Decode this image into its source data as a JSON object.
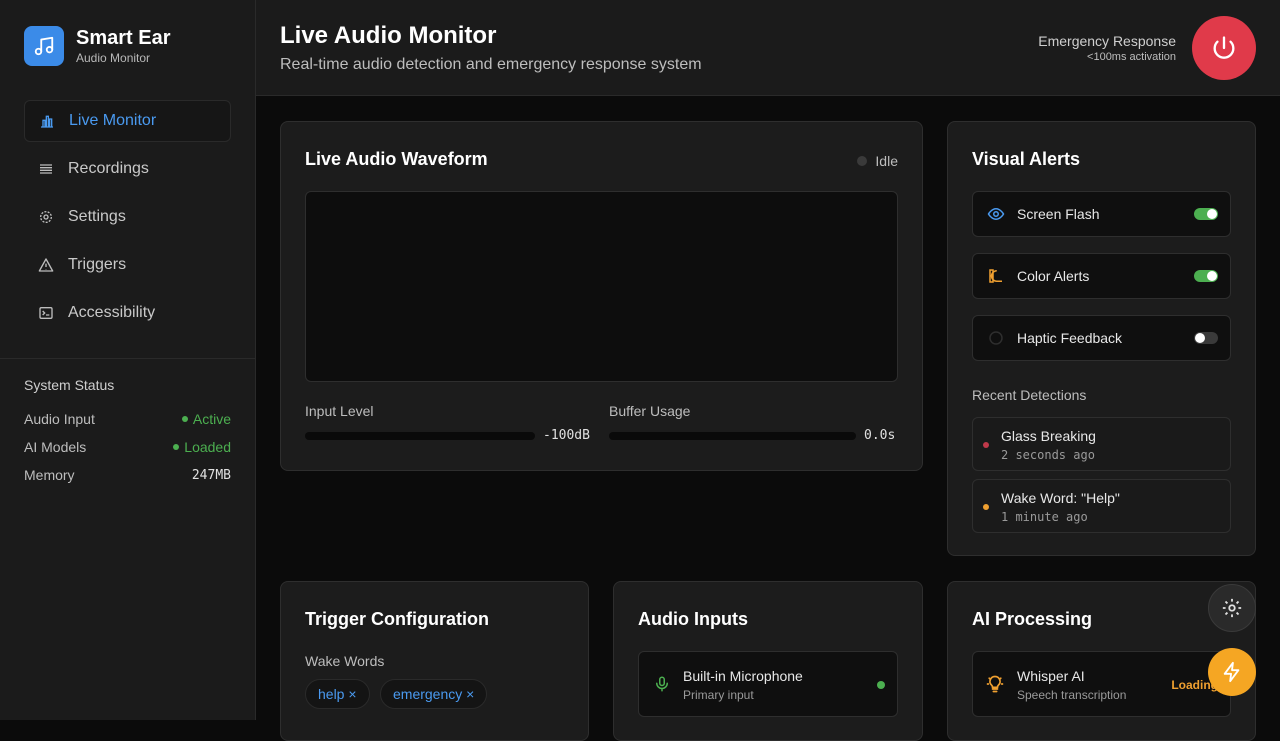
{
  "brand": {
    "title": "Smart Ear",
    "subtitle": "Audio Monitor"
  },
  "nav": {
    "items": [
      {
        "label": "Live Monitor",
        "icon": "bar-chart-icon",
        "active": true
      },
      {
        "label": "Recordings",
        "icon": "list-icon"
      },
      {
        "label": "Settings",
        "icon": "gear-icon"
      },
      {
        "label": "Triggers",
        "icon": "warning-icon"
      },
      {
        "label": "Accessibility",
        "icon": "terminal-icon"
      }
    ]
  },
  "system_status": {
    "title": "System Status",
    "rows": [
      {
        "label": "Audio Input",
        "value": "Active"
      },
      {
        "label": "AI Models",
        "value": "Loaded"
      },
      {
        "label": "Memory",
        "value": "247MB"
      }
    ]
  },
  "header": {
    "title": "Live Audio Monitor",
    "subtitle": "Real-time audio detection and emergency response system",
    "emergency_title": "Emergency Response",
    "emergency_sub": "<100ms activation"
  },
  "waveform": {
    "title": "Live Audio Waveform",
    "state": "Idle",
    "input_level_label": "Input Level",
    "input_level_value": "-100dB",
    "input_level_fraction": 0,
    "buffer_label": "Buffer Usage",
    "buffer_value": "0.0s",
    "buffer_fraction": 0
  },
  "visual_alerts": {
    "title": "Visual Alerts",
    "items": [
      {
        "label": "Screen Flash",
        "icon": "eye-icon",
        "enabled": true
      },
      {
        "label": "Color Alerts",
        "icon": "palette-icon",
        "enabled": true
      },
      {
        "label": "Haptic Feedback",
        "icon": "vibrate-icon",
        "enabled": false
      }
    ],
    "recent_title": "Recent Detections",
    "recent": [
      {
        "name": "Glass Breaking",
        "time": "2 seconds ago",
        "color": "#c0394a"
      },
      {
        "name": "Wake Word: \"Help\"",
        "time": "1 minute ago",
        "color": "#f0a030"
      }
    ]
  },
  "trigger_config": {
    "title": "Trigger Configuration",
    "wake_words_label": "Wake Words",
    "wake_words": [
      "help ×",
      "emergency ×"
    ]
  },
  "audio_inputs": {
    "title": "Audio Inputs",
    "items": [
      {
        "name": "Built-in Microphone",
        "sub": "Primary input",
        "status_color": "#4caf50"
      }
    ]
  },
  "ai_processing": {
    "title": "AI Processing",
    "items": [
      {
        "name": "Whisper AI",
        "sub": "Speech transcription",
        "status": "Loading"
      }
    ]
  },
  "colors": {
    "accent": "#3b8be8",
    "danger": "#e03a4a",
    "success": "#4caf50",
    "warning": "#f5a623"
  }
}
